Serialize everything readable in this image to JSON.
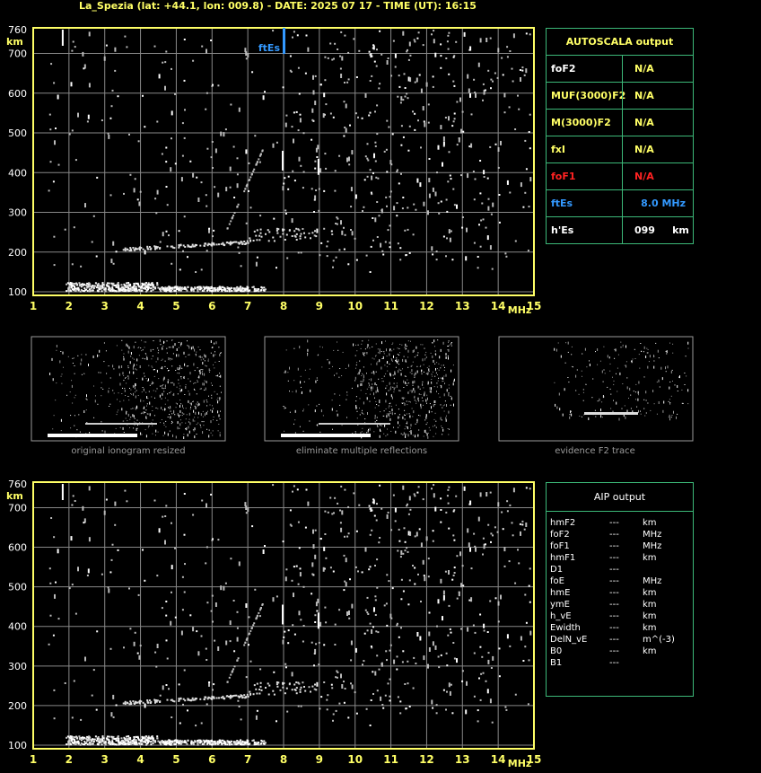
{
  "header": {
    "title": "La_Spezia (lat: +44.1, lon: 009.8) - DATE: 2025 07 17 - TIME (UT): 16:15"
  },
  "ionogram": {
    "y_ticks": [
      "760",
      "700",
      "600",
      "500",
      "400",
      "300",
      "200",
      "100"
    ],
    "y_unit": "km",
    "x_ticks": [
      "1",
      "2",
      "3",
      "4",
      "5",
      "6",
      "7",
      "8",
      "9",
      "10",
      "11",
      "12",
      "13",
      "14",
      "15"
    ],
    "x_unit": "MHz",
    "marker_label": "ftEs",
    "marker_freq_mhz": 8.0
  },
  "thumbnails": {
    "captions": [
      "original ionogram resized",
      "eliminate multiple reflections",
      "evidence F2 trace"
    ]
  },
  "autoscala": {
    "title": "AUTOSCALA output",
    "rows": [
      {
        "key": "foF2",
        "value": "N/A",
        "key_color": "#ffffff",
        "value_color": "#ffff66"
      },
      {
        "key": "MUF(3000)F2",
        "value": "N/A",
        "key_color": "#ffff66",
        "value_color": "#ffff66"
      },
      {
        "key": "M(3000)F2",
        "value": "N/A",
        "key_color": "#ffff66",
        "value_color": "#ffff66"
      },
      {
        "key": "fxI",
        "value": "N/A",
        "key_color": "#ffff66",
        "value_color": "#ffff66"
      },
      {
        "key": "foF1",
        "value": "N/A",
        "key_color": "#ff2222",
        "value_color": "#ff2222"
      },
      {
        "key": "ftEs",
        "value": "8.0 MHz",
        "key_color": "#3399ff",
        "value_color": "#3399ff"
      },
      {
        "key": "h'Es",
        "value": "099     km",
        "key_color": "#ffffff",
        "value_color": "#ffffff"
      }
    ]
  },
  "aip": {
    "title": "AIP output",
    "rows": [
      {
        "name": "hmF2",
        "value": "---",
        "unit": "km"
      },
      {
        "name": "foF2",
        "value": "---",
        "unit": "MHz"
      },
      {
        "name": "foF1",
        "value": "---",
        "unit": "MHz"
      },
      {
        "name": "hmF1",
        "value": "---",
        "unit": "km"
      },
      {
        "name": "D1",
        "value": "---",
        "unit": ""
      },
      {
        "name": "foE",
        "value": "---",
        "unit": "MHz"
      },
      {
        "name": "hmE",
        "value": "---",
        "unit": "km"
      },
      {
        "name": "ymE",
        "value": "---",
        "unit": "km"
      },
      {
        "name": "h_vE",
        "value": "---",
        "unit": "km"
      },
      {
        "name": "Ewidth",
        "value": "---",
        "unit": "km"
      },
      {
        "name": "DelN_vE",
        "value": "---",
        "unit": "m^(-3)"
      },
      {
        "name": "B0",
        "value": "---",
        "unit": "km"
      },
      {
        "name": "B1",
        "value": "---",
        "unit": ""
      }
    ]
  },
  "colors": {
    "frame": "#ffff66",
    "grid": "#888888",
    "panel_border": "#3cb878",
    "ftes_marker": "#3399ff"
  }
}
